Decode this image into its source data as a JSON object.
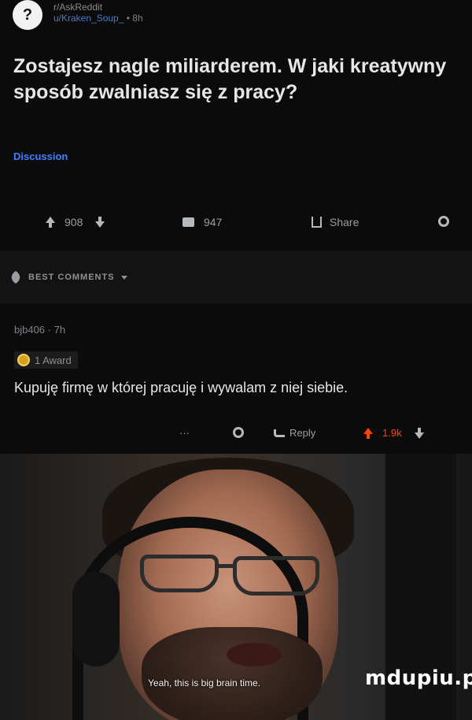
{
  "post": {
    "subreddit": "r/AskReddit",
    "author": "u/Kraken_Soup_",
    "age": "8h",
    "avatar_glyph": "?",
    "title": "Zostajesz nagle miliarderem. W jaki kreatywny sposób zwalniasz się z pracy?",
    "flair": "Discussion",
    "upvotes": "908",
    "comments": "947",
    "share_label": "Share"
  },
  "sort": {
    "label": "BEST COMMENTS"
  },
  "comment": {
    "author": "bjb406",
    "age": "7h",
    "award": "1 Award",
    "body": "Kupuję firmę w której pracuję i wywalam z niej siebie.",
    "more": "···",
    "reply_label": "Reply",
    "score": "1.9k"
  },
  "video": {
    "caption": "Yeah, this is big brain time.",
    "watermark": "mdupiu.pl"
  },
  "colors": {
    "accent_upvote": "#ff4500",
    "flair": "#3f82ff",
    "author": "#4a79c8"
  }
}
